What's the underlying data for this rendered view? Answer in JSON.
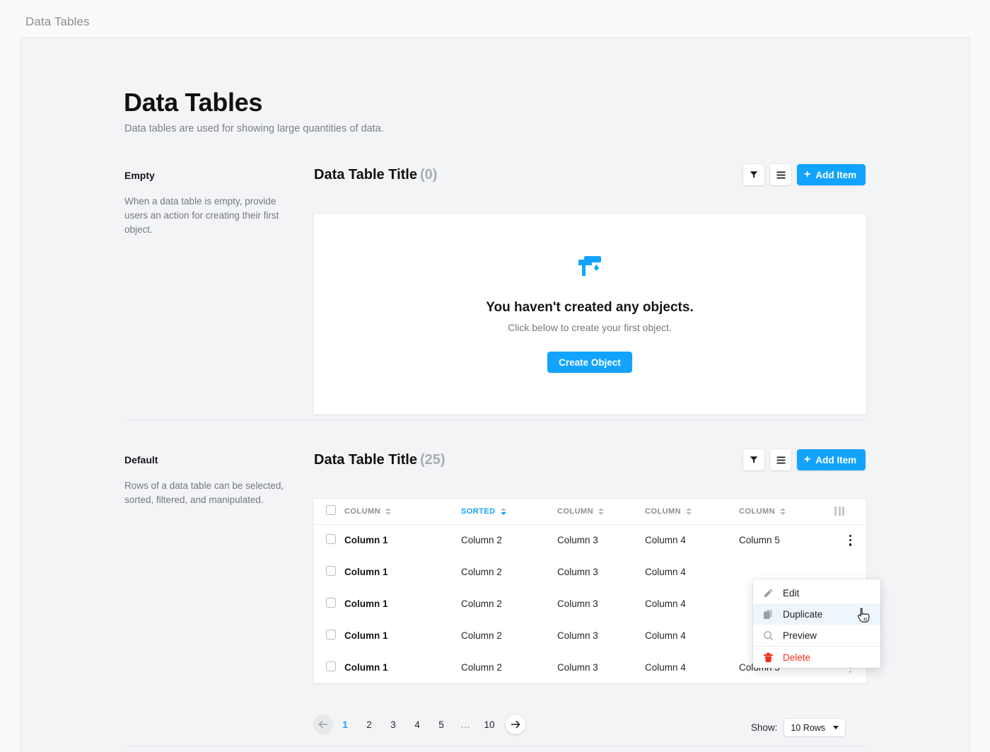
{
  "breadcrumb": "Data Tables",
  "page": {
    "title": "Data Tables",
    "subtitle": "Data tables are used for showing large quantities of data."
  },
  "accent_color": "#12a3ff",
  "danger_color": "#f4311f",
  "sections": [
    {
      "label": "Empty",
      "description": "When a data table is empty, provide users an action for creating their first object.",
      "table_title": "Data Table Title",
      "table_count": "(0)",
      "toolbar": {
        "filter_icon": "funnel-icon",
        "list_icon": "list-icon",
        "add_label": "Add Item",
        "add_plus": "+"
      },
      "empty_state": {
        "icon": "paint-roller-icon",
        "title": "You haven't created any objects.",
        "subtitle": "Click below to create your first object.",
        "button_label": "Create Object"
      }
    },
    {
      "label": "Default",
      "description": "Rows of a data table can be selected, sorted, filtered, and manipulated.",
      "table_title": "Data Table Title",
      "table_count": "(25)",
      "toolbar": {
        "filter_icon": "funnel-icon",
        "list_icon": "list-icon",
        "add_label": "Add Item",
        "add_plus": "+"
      }
    }
  ],
  "table": {
    "headers": [
      {
        "label": "COLUMN",
        "sorted": false
      },
      {
        "label": "SORTED",
        "sorted": true
      },
      {
        "label": "COLUMN",
        "sorted": false
      },
      {
        "label": "COLUMN",
        "sorted": false
      },
      {
        "label": "COLUMN",
        "sorted": false
      }
    ],
    "columns_icon": "column-settings-icon",
    "rows": [
      {
        "c1": "Column 1",
        "c2": "Column 2",
        "c3": "Column 3",
        "c4": "Column 4",
        "c5": "Column 5",
        "menu_active": true
      },
      {
        "c1": "Column 1",
        "c2": "Column 2",
        "c3": "Column 3",
        "c4": "Column 4",
        "c5": "",
        "menu_active": false
      },
      {
        "c1": "Column 1",
        "c2": "Column 2",
        "c3": "Column 3",
        "c4": "Column 4",
        "c5": "",
        "menu_active": false
      },
      {
        "c1": "Column 1",
        "c2": "Column 2",
        "c3": "Column 3",
        "c4": "Column 4",
        "c5": "",
        "menu_active": false
      },
      {
        "c1": "Column 1",
        "c2": "Column 2",
        "c3": "Column 3",
        "c4": "Column 4",
        "c5": "Column 5",
        "menu_active": false
      }
    ]
  },
  "context_menu": {
    "items": [
      {
        "label": "Edit",
        "icon": "pencil-icon",
        "hover": false,
        "danger": false
      },
      {
        "label": "Duplicate",
        "icon": "duplicate-icon",
        "hover": true,
        "danger": false
      },
      {
        "label": "Preview",
        "icon": "magnifier-icon",
        "hover": false,
        "danger": false
      },
      {
        "label": "Delete",
        "icon": "trash-icon",
        "hover": false,
        "danger": true
      }
    ]
  },
  "pagination": {
    "prev_icon": "arrow-left-icon",
    "next_icon": "arrow-right-icon",
    "pages": [
      "1",
      "2",
      "3",
      "4",
      "5"
    ],
    "ellipsis": "…",
    "last_page": "10",
    "active_page": "1",
    "show_label": "Show:",
    "rows_value": "10 Rows"
  }
}
